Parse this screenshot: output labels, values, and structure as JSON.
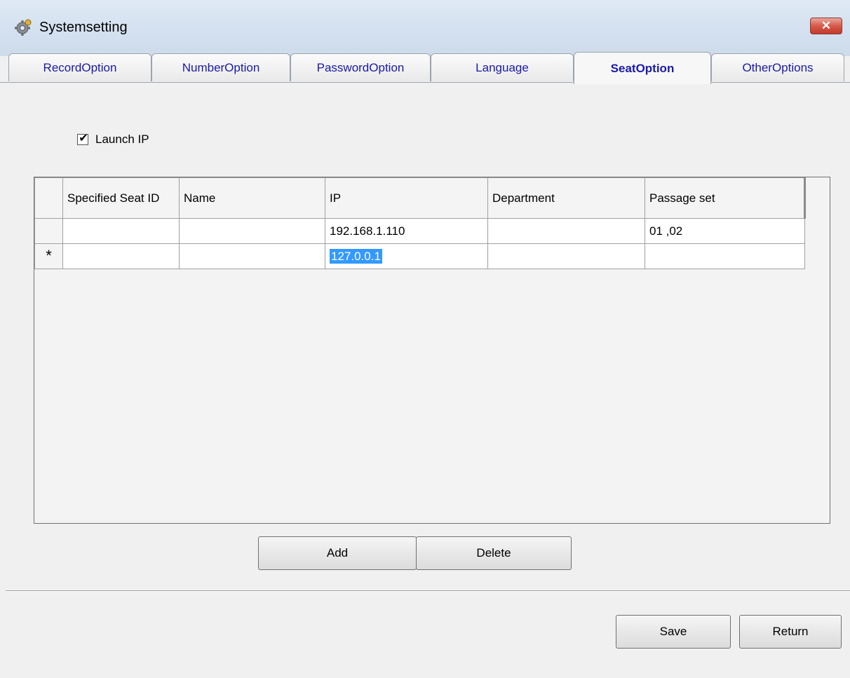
{
  "window": {
    "title": "Systemsetting",
    "close_label": "✕"
  },
  "tabs": [
    {
      "label": "RecordOption",
      "active": false
    },
    {
      "label": "NumberOption",
      "active": false
    },
    {
      "label": "PasswordOption",
      "active": false
    },
    {
      "label": "Language",
      "active": false
    },
    {
      "label": "SeatOption",
      "active": true
    },
    {
      "label": "OtherOptions",
      "active": false
    }
  ],
  "launch_ip": {
    "label": "Launch IP",
    "checked": true
  },
  "grid": {
    "columns": [
      "Specified Seat ID",
      "Name",
      "IP",
      "Department",
      "Passage set"
    ],
    "rows": [
      {
        "seat_id": "",
        "name": "",
        "ip": "192.168.1.110",
        "department": "",
        "passage_set": "01 ,02"
      },
      {
        "marker": "*",
        "seat_id": "",
        "name": "",
        "ip": "127.0.0.1",
        "department": "",
        "passage_set": ""
      }
    ]
  },
  "buttons": {
    "add": "Add",
    "delete": "Delete",
    "save": "Save",
    "return": "Return"
  },
  "icons": {
    "app": "gear-icon",
    "close": "close-icon",
    "new_row": "asterisk-icon"
  }
}
